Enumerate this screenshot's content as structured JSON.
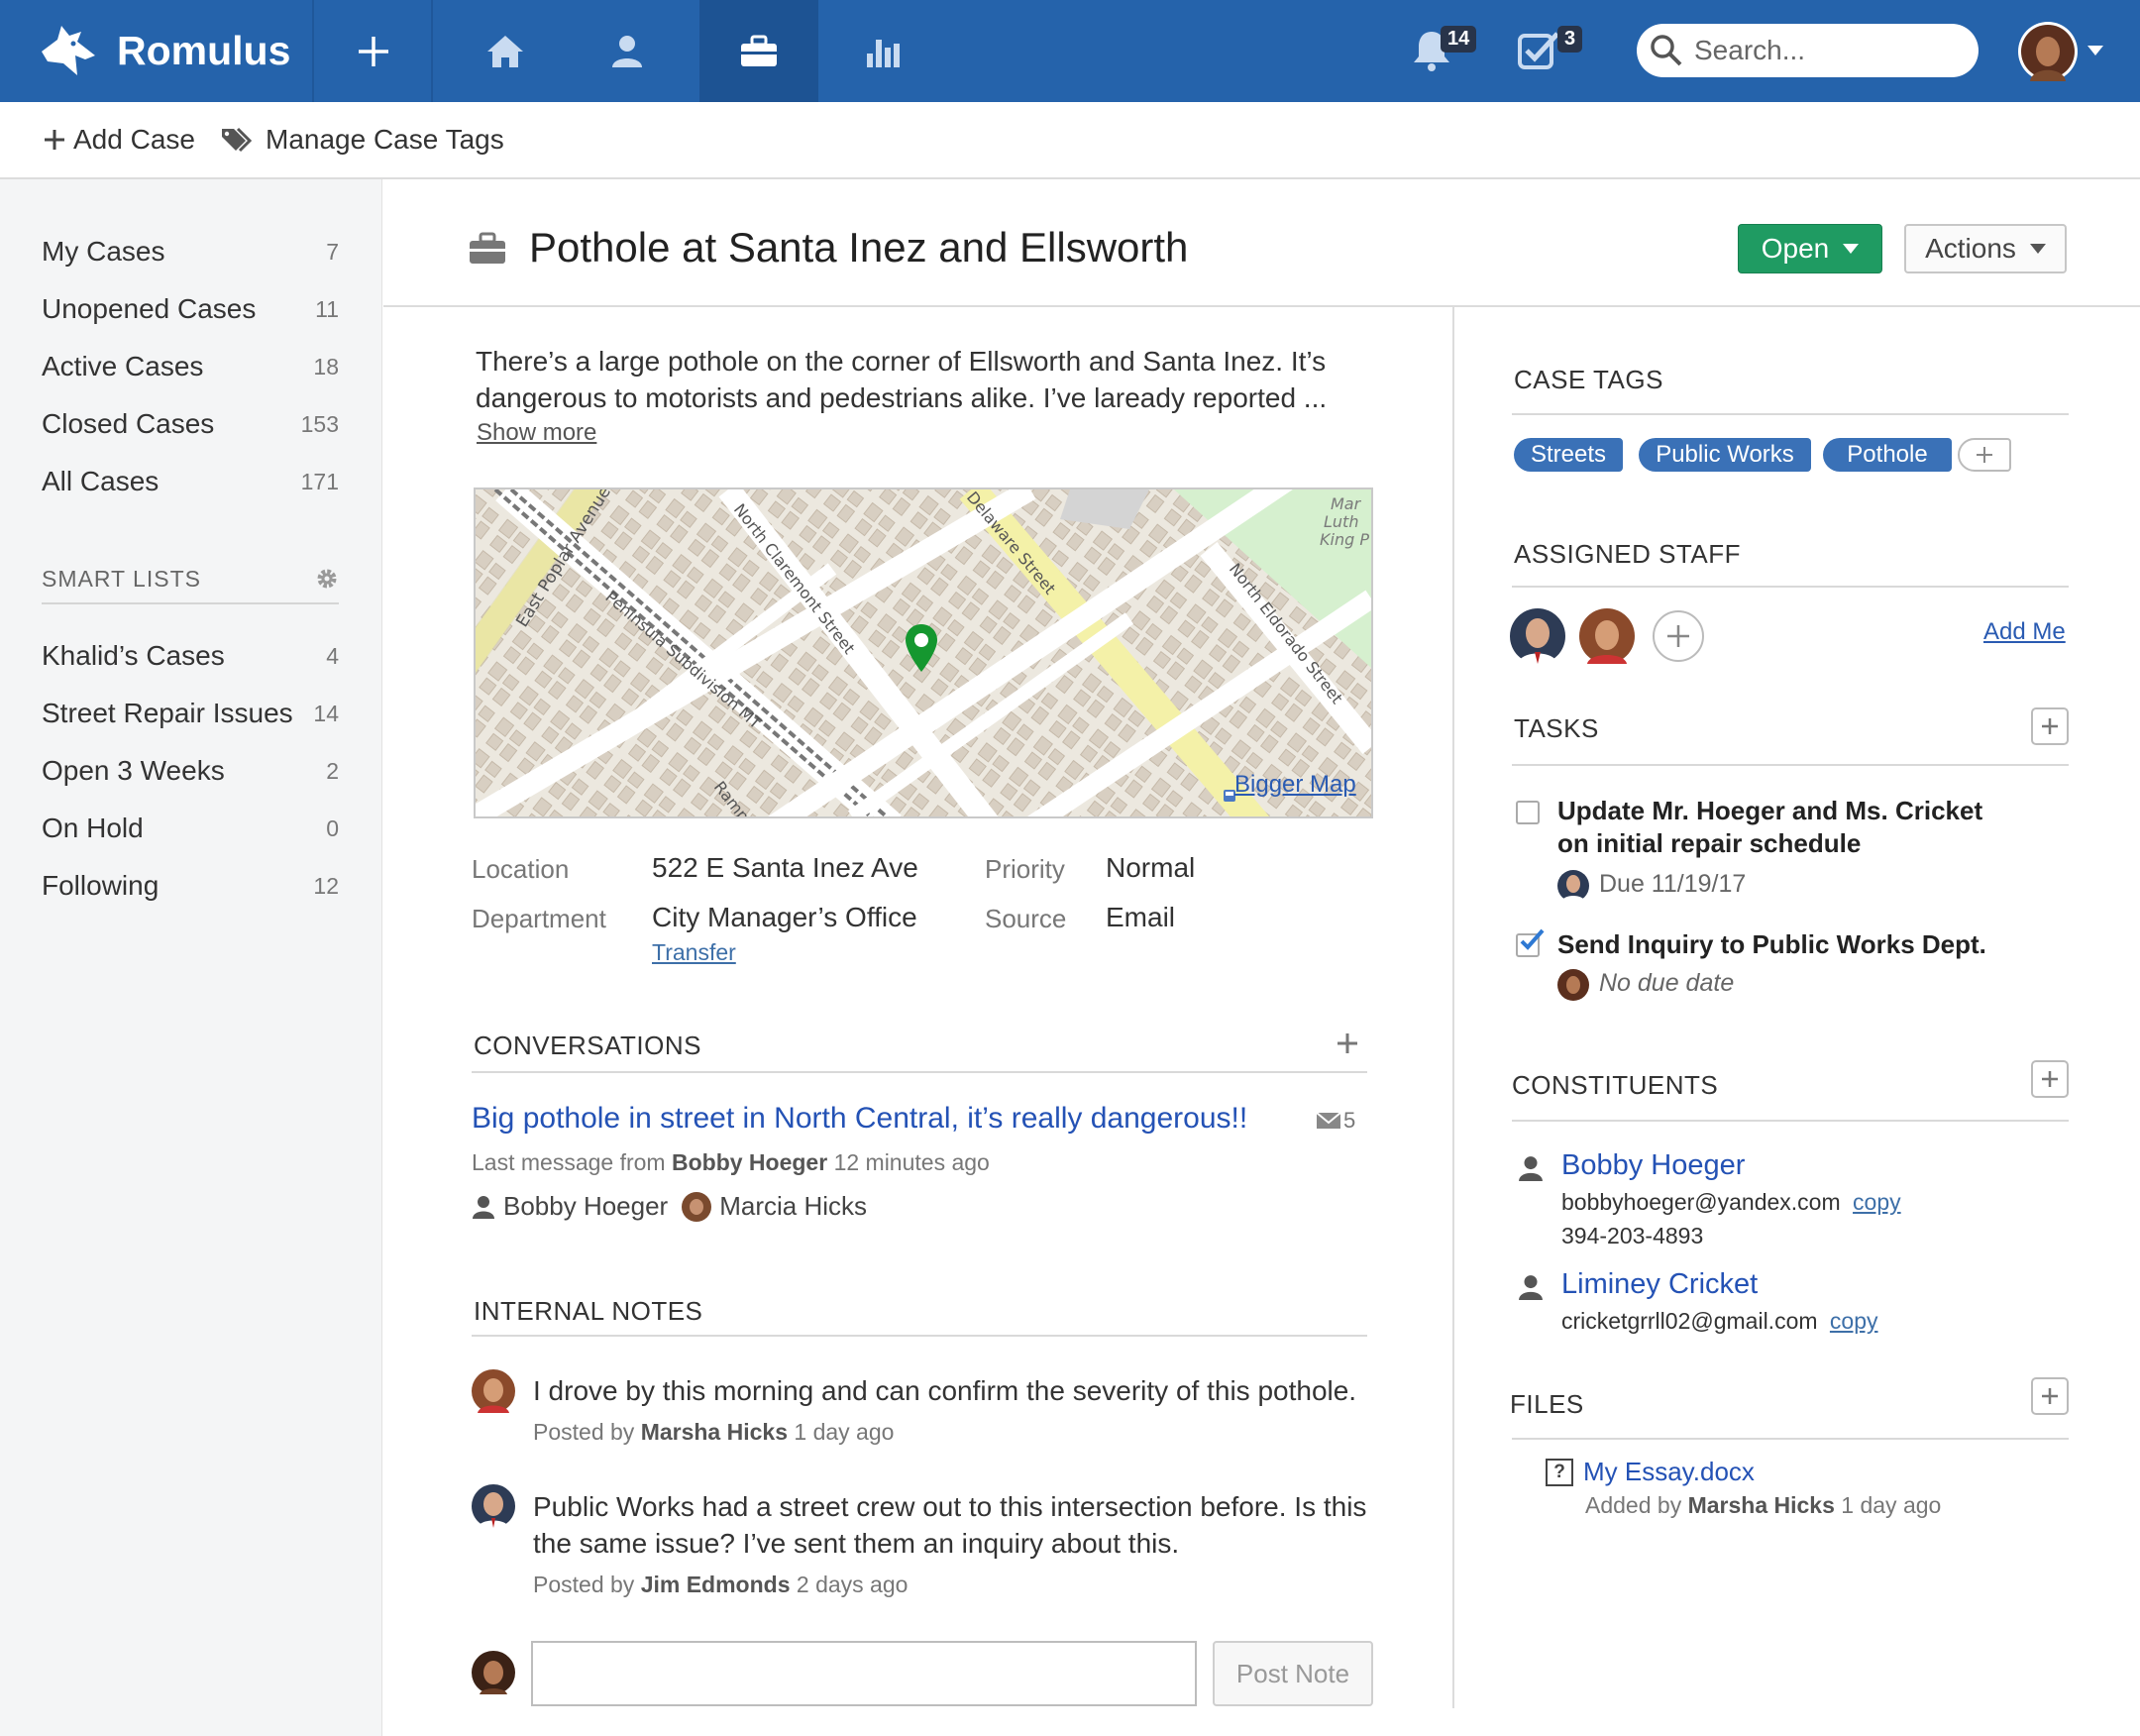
{
  "app": {
    "name": "Romulus"
  },
  "topbar": {
    "notifications_count": "14",
    "tasks_count": "3",
    "search_placeholder": "Search...",
    "colors": {
      "bar": "#2563ab",
      "active_tab": "#1d5393"
    }
  },
  "subbar": {
    "add_case": "Add Case",
    "manage_tags": "Manage Case Tags"
  },
  "sidebar": {
    "cases": [
      {
        "label": "My Cases",
        "count": "7"
      },
      {
        "label": "Unopened Cases",
        "count": "11"
      },
      {
        "label": "Active Cases",
        "count": "18"
      },
      {
        "label": "Closed Cases",
        "count": "153"
      },
      {
        "label": "All Cases",
        "count": "171"
      }
    ],
    "smart_lists_heading": "SMART LISTS",
    "smart_lists": [
      {
        "label": "Khalid’s Cases",
        "count": "4"
      },
      {
        "label": "Street Repair Issues",
        "count": "14"
      },
      {
        "label": "Open 3 Weeks",
        "count": "2"
      },
      {
        "label": "On Hold",
        "count": "0"
      },
      {
        "label": "Following",
        "count": "12"
      }
    ]
  },
  "case": {
    "title": "Pothole at Santa Inez and Ellsworth",
    "status": "Open",
    "actions": "Actions",
    "description_line1": "There’s a large pothole on the corner of Ellsworth and Santa Inez.  It’s",
    "description_line2": "dangerous to motorists and pedestrians alike. I’ve laready reported ...",
    "show_more": "Show more",
    "map": {
      "bigger_map": "Bigger Map",
      "streets": [
        "East Poplar Avenue",
        "Peninsula Subdivision MT",
        "North Claremont Street",
        "Delaware Street",
        "North Eldorado Street",
        "Martin Luther King Ramp"
      ]
    },
    "details": {
      "location_label": "Location",
      "location": "522 E Santa Inez Ave",
      "department_label": "Department",
      "department": "City Manager’s Office",
      "transfer": "Transfer",
      "priority_label": "Priority",
      "priority": "Normal",
      "source_label": "Source",
      "source": "Email"
    },
    "conversations": {
      "heading": "CONVERSATIONS",
      "subject": "Big pothole in street in North Central, it’s really dangerous!!",
      "message_count": "5",
      "last_prefix": "Last message from",
      "last_from": "Bobby Hoeger",
      "last_time": "12 minutes ago",
      "participants": [
        "Bobby Hoeger",
        "Marcia Hicks"
      ]
    },
    "notes": {
      "heading": "INTERNAL NOTES",
      "items": [
        {
          "text": "I drove by this morning and can confirm the severity of this pothole.",
          "prefix": "Posted by",
          "author": "Marsha Hicks",
          "time": "1 day ago"
        },
        {
          "text_line1": "Public Works had a street crew out to this intersection before. Is this",
          "text_line2": "the same issue? I’ve sent them an inquiry about this.",
          "prefix": "Posted by",
          "author": "Jim Edmonds",
          "time": "2 days ago"
        }
      ],
      "post_button": "Post Note"
    }
  },
  "right": {
    "tags_heading": "CASE TAGS",
    "tags": [
      "Streets",
      "Public Works",
      "Pothole"
    ],
    "staff_heading": "ASSIGNED STAFF",
    "add_me": "Add Me",
    "tasks_heading": "TASKS",
    "tasks": [
      {
        "line1": "Update Mr. Hoeger and Ms. Cricket",
        "line2": "on initial repair schedule",
        "due": "Due 11/19/17",
        "checked": false
      },
      {
        "line1": "Send Inquiry to Public Works Dept.",
        "due": "No due date",
        "checked": true
      }
    ],
    "constituents_heading": "CONSTITUENTS",
    "constituents": [
      {
        "name": "Bobby Hoeger",
        "email": "bobbyhoeger@yandex.com",
        "phone": "394-203-4893"
      },
      {
        "name": "Liminey Cricket",
        "email": "cricketgrrll02@gmail.com"
      }
    ],
    "copy": "copy",
    "files_heading": "FILES",
    "file": {
      "name": "My Essay.docx",
      "prefix": "Added by",
      "author": "Marsha Hicks",
      "time": "1 day ago"
    }
  }
}
